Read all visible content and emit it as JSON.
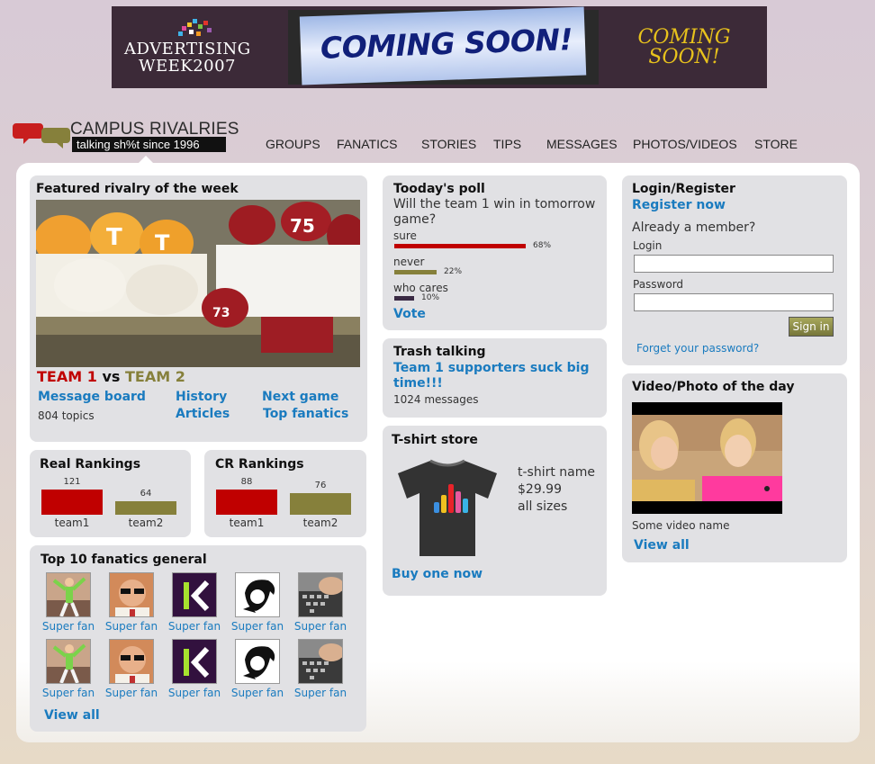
{
  "ad": {
    "left_line1": "ADVERTISING",
    "left_line2": "WEEK2007",
    "center": "COMING SOON!",
    "right_line1": "COMING",
    "right_line2": "SOON!"
  },
  "header": {
    "logo_title": "CAMPUS RIVALRIES",
    "logo_tagline": "talking sh%t since 1996",
    "nav": [
      "GROUPS",
      "FANATICS",
      "STORIES",
      "TIPS",
      "MESSAGES",
      "PHOTOS/VIDEOS",
      "STORE"
    ]
  },
  "featured": {
    "title": "Featured rivalry of the week",
    "team1": "TEAM 1",
    "vs": "vs",
    "team2": "TEAM 2",
    "message_board": "Message board",
    "topics": "804 topics",
    "history": "History",
    "articles": "Articles",
    "next_game": "Next game",
    "top_fanatics": "Top fanatics"
  },
  "real_rankings": {
    "title": "Real Rankings",
    "items": [
      {
        "label": "team1",
        "value": "121",
        "num": 121,
        "color": "#c00000"
      },
      {
        "label": "team2",
        "value": "64",
        "num": 64,
        "color": "#86803b"
      }
    ]
  },
  "cr_rankings": {
    "title": "CR Rankings",
    "items": [
      {
        "label": "team1",
        "value": "88",
        "num": 88,
        "color": "#c00000"
      },
      {
        "label": "team2",
        "value": "76",
        "num": 76,
        "color": "#86803b"
      }
    ]
  },
  "fanatics": {
    "title": "Top 10 fanatics general",
    "label": "Super fan",
    "view_all": "View all",
    "icons": [
      "dancer-icon",
      "sunglasses-man-icon",
      "k-logo-icon",
      "sketch-face-icon",
      "keyboard-hand-icon"
    ]
  },
  "poll": {
    "title": "Tooday's poll",
    "question": "Will the team 1 win in tomorrow game?",
    "options": [
      {
        "label": "sure",
        "pct": "68%",
        "value": 68,
        "color": "#c00000"
      },
      {
        "label": "never",
        "pct": "22%",
        "value": 22,
        "color": "#86803b"
      },
      {
        "label": "who cares",
        "pct": "10%",
        "value": 10,
        "color": "#3a2a44"
      }
    ],
    "vote": "Vote"
  },
  "trash": {
    "title": "Trash talking",
    "headline": "Team 1 supporters suck big time!!!",
    "count": "1024 messages"
  },
  "store": {
    "title": "T-shirt store",
    "name": "t-shirt name",
    "price": "$29.99",
    "sizes": "all sizes",
    "buy": "Buy one now"
  },
  "login": {
    "title": "Login/Register",
    "register": "Register now",
    "member": "Already a member?",
    "login_label": "Login",
    "login_value": "",
    "password_label": "Password",
    "password_value": "",
    "signin": "Sign in",
    "forgot": "Forget your password?"
  },
  "video": {
    "title": "Video/Photo of the day",
    "name": "Some video name",
    "view_all": "View all"
  },
  "colors": {
    "team1": "#c00000",
    "team2": "#86803b",
    "link": "#1a7bbf"
  }
}
